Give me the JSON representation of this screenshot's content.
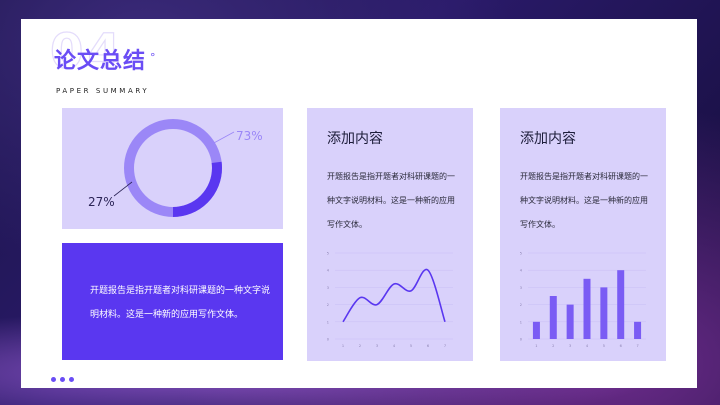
{
  "header": {
    "number": "04",
    "title": "论文总结",
    "title_mark": "°",
    "subtitle": "PAPER SUMMARY"
  },
  "ring": {
    "value_pct": 73,
    "label_major": "73%",
    "label_minor": "27%",
    "colors": {
      "major": "#9b87f7",
      "minor": "#5a37f0"
    }
  },
  "text_block": {
    "body": "开题报告是指开题者对科研课题的一种文字说明材料。这是一种新的应用写作文体。"
  },
  "panels": [
    {
      "heading": "添加内容",
      "body": "开题报告是指开题者对科研课题的一种文字说明材料。这是一种新的应用写作文体。",
      "chart_data": {
        "type": "line",
        "x": [
          1,
          2,
          3,
          4,
          5,
          6,
          7
        ],
        "y": [
          1,
          2.4,
          2,
          3.2,
          2.8,
          4,
          1
        ],
        "ylim": [
          0,
          5
        ],
        "grid": true,
        "xticks": [
          "1",
          "2",
          "3",
          "4",
          "5",
          "6",
          "7"
        ],
        "yticks": [
          "0",
          "1",
          "2",
          "3",
          "4",
          "5"
        ]
      }
    },
    {
      "heading": "添加内容",
      "body": "开题报告是指开题者对科研课题的一种文字说明材料。这是一种新的应用写作文体。",
      "chart_data": {
        "type": "bar",
        "categories": [
          "1",
          "2",
          "3",
          "4",
          "5",
          "6",
          "7"
        ],
        "values": [
          1,
          2.5,
          2,
          3.5,
          3,
          4,
          1
        ],
        "ylim": [
          0,
          5
        ],
        "grid": true,
        "yticks": [
          "0",
          "1",
          "2",
          "3",
          "4",
          "5"
        ]
      }
    }
  ],
  "colors": {
    "accent": "#6a4df5",
    "panel_bg": "#d9d1fb",
    "text_block_bg": "#5a37f0",
    "bar": "#7a5cf4"
  }
}
